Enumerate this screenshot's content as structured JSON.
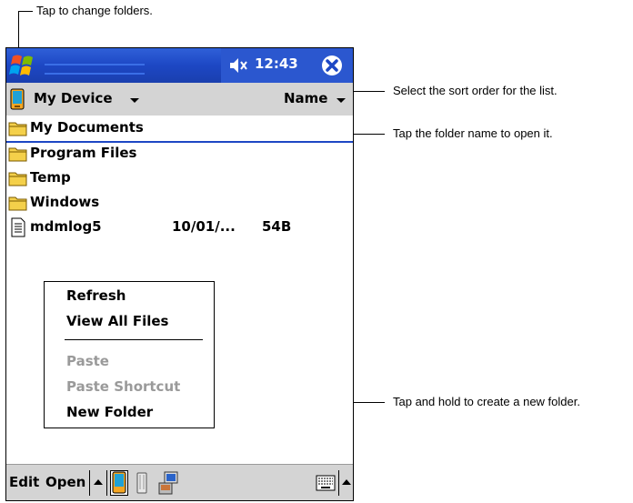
{
  "callouts": {
    "change_folders": "Tap to change folders.",
    "sort_order": "Select the sort order for the list.",
    "open_folder": "Tap the folder name to open it.",
    "new_folder": "Tap and hold to create a new folder."
  },
  "title_bar": {
    "time": "12:43",
    "icons": [
      "windows-start-icon",
      "speaker-icon",
      "close-icon"
    ]
  },
  "nav": {
    "folder": "My Device",
    "sort": "Name"
  },
  "files": [
    {
      "name": "My Documents",
      "type": "folder",
      "selected": true
    },
    {
      "name": "Program Files",
      "type": "folder"
    },
    {
      "name": "Temp",
      "type": "folder"
    },
    {
      "name": "Windows",
      "type": "folder"
    },
    {
      "name": "mdmlog5",
      "type": "document",
      "date": "10/01/...",
      "size": "54B"
    }
  ],
  "context_menu": {
    "items": [
      {
        "label": "Refresh",
        "enabled": true
      },
      {
        "label": "View All Files",
        "enabled": true
      },
      {
        "label": "Paste",
        "enabled": false
      },
      {
        "label": "Paste Shortcut",
        "enabled": false
      },
      {
        "label": "New Folder",
        "enabled": true
      }
    ]
  },
  "command_bar": {
    "edit": "Edit",
    "open": "Open"
  },
  "colors": {
    "title_bar": "#1d47c4",
    "folder_yellow": "#f4d04a",
    "selection_line": "#1d47c4",
    "disabled_text": "#9a9a9a"
  }
}
